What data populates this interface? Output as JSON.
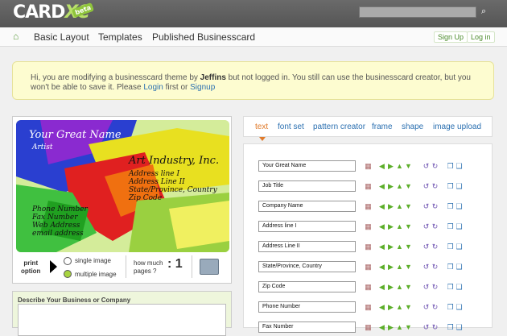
{
  "logo": {
    "text": "CARD",
    "accent": "XC",
    "badge": "beta"
  },
  "search": {
    "placeholder": ""
  },
  "nav": {
    "items": [
      "Basic Layout",
      "Templates",
      "Published Businesscard"
    ],
    "signup": "Sign Up",
    "login": "Log in"
  },
  "notice": {
    "before": "Hi, you are modifying a businesscard theme by ",
    "user": "Jeffins",
    "middle": " but not logged in. You still can use the businesscard creator, but you won't be able to save it. Please ",
    "login": "Login",
    "or": " first or ",
    "signup": "Signup"
  },
  "card": {
    "name": "Your Great Name",
    "title": "Artist",
    "company": "Art Industry, Inc.",
    "address_lines": [
      "Address line I",
      "Address Line II",
      "State/Province, Country",
      "Zip Code"
    ],
    "contact_lines": [
      "Phone Number",
      "Fax Number",
      "Web Address",
      "email address"
    ]
  },
  "print": {
    "label_line1": "print",
    "label_line2": "option",
    "single": "single image",
    "multiple": "multiple image",
    "pages_line1": "how much",
    "pages_line2": "pages ?",
    "pages_value": ": 1"
  },
  "describe": {
    "label": "Describe Your Business or Company"
  },
  "tabs": [
    "text",
    "font set",
    "pattern creator",
    "frame",
    "shape",
    "image upload"
  ],
  "fields": [
    "Your Great Name",
    "Job Title",
    "Company Name",
    "Address line I",
    "Address Line II",
    "State/Province, Country",
    "Zip Code",
    "Phone Number",
    "Fax Number"
  ],
  "icons": {
    "grid": "grid-icon",
    "left": "arrow-left-icon",
    "right": "arrow-right-icon",
    "up": "arrow-up-icon",
    "down": "arrow-down-icon",
    "ccw": "rotate-ccw-icon",
    "cw": "rotate-cw-icon",
    "shrink": "shrink-icon",
    "expand": "expand-icon"
  },
  "colors": {
    "topbar": "#5f5f5f",
    "accent_green": "#8fc43c",
    "link_blue": "#2a6fb0",
    "active_tab": "#e07a2a",
    "notice_bg": "#fdfcd0"
  }
}
